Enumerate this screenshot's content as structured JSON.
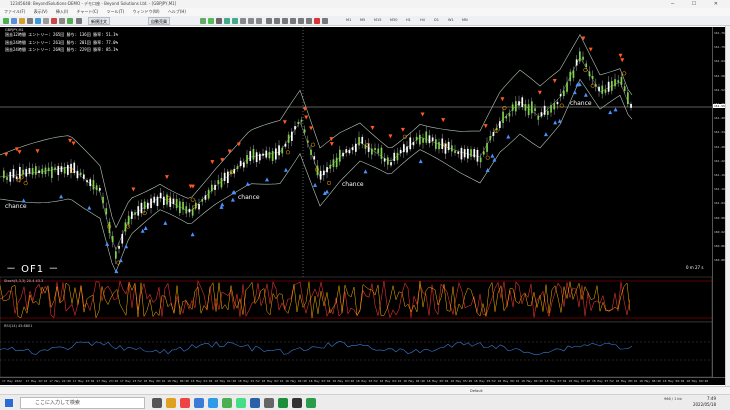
{
  "window": {
    "title": "12345648: BeyondSolutions-DEMO - デモ口座 - Beyond Solutions Ltd. - [GBPJPY,M1]",
    "controls": "─ ☐ ✕"
  },
  "menu": [
    "ファイル(F)",
    "表示(V)",
    "挿入(I)",
    "チャート(C)",
    "ツール(T)",
    "ウィンドウ(W)",
    "ヘルプ(H)"
  ],
  "toolbar": {
    "new_order": "新規注文",
    "auto_trade": "自動売買",
    "timeframes": [
      "M1",
      "M5",
      "M15",
      "M30",
      "H1",
      "H4",
      "D1",
      "W1",
      "MN"
    ]
  },
  "chart": {
    "symbol": "GBPJPY,M1",
    "stats": [
      "過去12時間  エントリー: 265回  勝ち: 136回  勝率: 51.1%",
      "過去24時間  エントリー: 261回  勝ち: 201回  勝率: 77.0%",
      "過去24時間  エントリー: 269回  勝ち: 229回  勝率: 85.1%"
    ],
    "annotations": [
      "chance",
      "chance",
      "chance",
      "chance"
    ],
    "brand": "－ OF1 －",
    "timer": "0 m 27 s",
    "stoch_label": "Stoch(5,3,3) 20.4  43.3",
    "rsi_label": "RSI(14) 45.6801",
    "price_labels": [
      "161.760",
      "161.700",
      "161.640",
      "161.580",
      "161.520",
      "161.460",
      "161.400",
      "161.340",
      "161.280",
      "161.220",
      "161.160",
      "161.100",
      "161.040",
      "160.980",
      "160.920",
      "160.860",
      "160.800"
    ],
    "current_price": "161.593",
    "time_labels": [
      "17 May 2022",
      "17 May 22:16",
      "17 May 22:40",
      "17 May 23:04",
      "17 May 23:28",
      "17 May 23:52",
      "18 May 00:16",
      "18 May 00:40",
      "18 May 01:04",
      "18 May 01:28",
      "18 May 01:52",
      "18 May 02:16",
      "18 May 02:40",
      "18 May 03:04",
      "18 May 03:28",
      "18 May 03:52",
      "18 May 04:16",
      "18 May 04:40",
      "18 May 05:04",
      "18 May 05:28",
      "18 May 05:52",
      "18 May 06:16",
      "18 May 06:40",
      "18 May 07:04",
      "18 May 07:28",
      "18 May 07:52",
      "18 May 08:16",
      "18 May 08:40",
      "18 May 09:04",
      "18 May 09:28"
    ]
  },
  "tabs": [
    "Default"
  ],
  "taskbar": {
    "search_placeholder": "ここに入力して検索",
    "network": "966 / 1 kb",
    "time": "7:49",
    "date": "2022/05/18"
  },
  "colors": {
    "bull": "#7fd34a",
    "bear": "#ffffff",
    "band": "#b4c8b4",
    "up_arrow": "#ff5a1f",
    "down_arrow": "#4a90ff",
    "stoch_main": "#e03030",
    "stoch_signal": "#ffb300"
  }
}
